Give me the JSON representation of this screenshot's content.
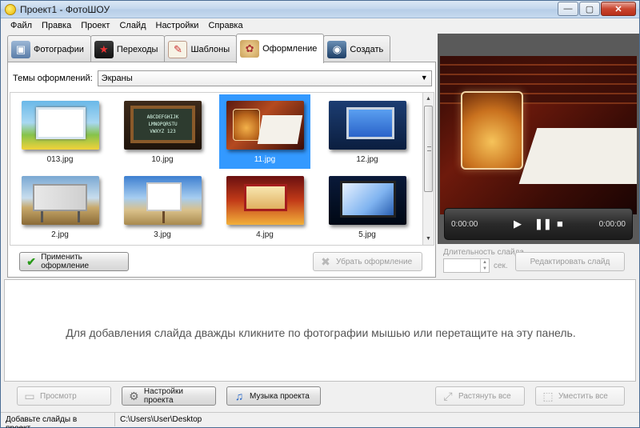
{
  "window": {
    "title": "Проект1 - ФотоШОУ",
    "min": "—",
    "max": "▢",
    "close": "✕"
  },
  "menu": [
    "Файл",
    "Правка",
    "Проект",
    "Слайд",
    "Настройки",
    "Справка"
  ],
  "tabs": [
    {
      "label": "Фотографии",
      "icon": "photos-icon"
    },
    {
      "label": "Переходы",
      "icon": "transitions-icon"
    },
    {
      "label": "Шаблоны",
      "icon": "templates-icon"
    },
    {
      "label": "Оформление",
      "icon": "palette-icon"
    },
    {
      "label": "Создать",
      "icon": "camera-icon"
    }
  ],
  "active_tab": "Оформление",
  "themes": {
    "label": "Темы оформлений:",
    "selected": "Экраны"
  },
  "thumbnails": [
    {
      "name": "013.jpg"
    },
    {
      "name": "10.jpg"
    },
    {
      "name": "11.jpg",
      "selected": true
    },
    {
      "name": "12.jpg"
    },
    {
      "name": "2.jpg"
    },
    {
      "name": "3.jpg"
    },
    {
      "name": "4.jpg"
    },
    {
      "name": "5.jpg"
    }
  ],
  "buttons": {
    "apply": "Применить оформление",
    "remove": "Убрать оформление",
    "edit_slide": "Редактировать слайд",
    "preview": "Просмотр",
    "project_settings": "Настройки проекта",
    "project_music": "Музыка проекта",
    "stretch_all": "Растянуть все",
    "fit_all": "Уместить все"
  },
  "player": {
    "time_current": "0:00:00",
    "time_total": "0:00:00"
  },
  "slide_duration": {
    "label": "Длительность слайда",
    "unit": "сек."
  },
  "timeline": {
    "hint": "Для добавления слайда дважды кликните по фотографии мышью или перетащите на эту панель."
  },
  "status": {
    "message": "Добавьте слайды в проект...",
    "path": "C:\\Users\\User\\Desktop"
  },
  "colors": {
    "selection": "#3399ff",
    "preview_bg": "#5a5a5a",
    "close_btn": "#c9452e"
  }
}
